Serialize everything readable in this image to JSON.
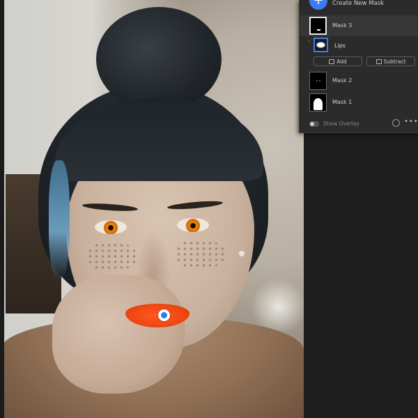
{
  "masks_panel": {
    "create_label": "Create New Mask",
    "create_icon": "plus-icon",
    "masks": [
      {
        "label": "Mask 3",
        "selected": true
      },
      {
        "label": "Mask 2",
        "selected": false
      },
      {
        "label": "Mask 1",
        "selected": false
      }
    ],
    "components": [
      {
        "label": "Lips"
      }
    ],
    "add_label": "Add",
    "subtract_label": "Subtract",
    "show_overlay_label": "Show Overlay",
    "show_overlay_on": false,
    "more_label": "•••"
  },
  "colors": {
    "accent": "#3d7cf0",
    "panel_bg": "#2b2b2b",
    "app_bg": "#1e1e1e"
  }
}
